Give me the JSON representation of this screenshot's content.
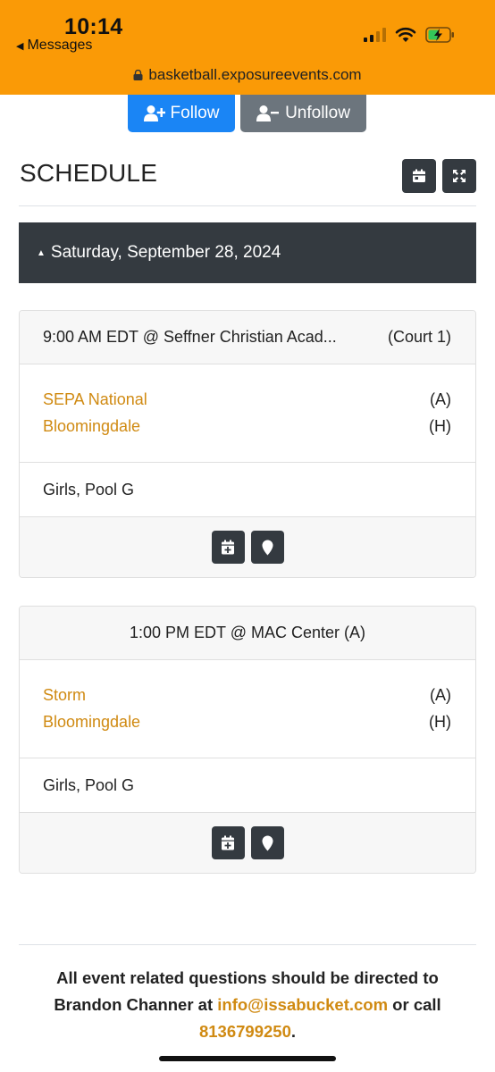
{
  "status_bar": {
    "time": "10:14",
    "back_label": "Messages",
    "url": "basketball.exposureevents.com",
    "chrome_color": "#fa9a06"
  },
  "actions": {
    "follow_label": "Follow",
    "unfollow_label": "Unfollow"
  },
  "schedule": {
    "title": "SCHEDULE",
    "date_header": "Saturday, September 28, 2024",
    "games": [
      {
        "time_location": "9:00 AM EDT @ Seffner Christian Acad...",
        "court": "(Court 1)",
        "teams": [
          {
            "name": "SEPA National",
            "side": "(A)"
          },
          {
            "name": "Bloomingdale",
            "side": "(H)"
          }
        ],
        "division": "Girls, Pool G"
      },
      {
        "time_location": "1:00 PM EDT @ MAC Center (A)",
        "court": "",
        "teams": [
          {
            "name": "Storm",
            "side": "(A)"
          },
          {
            "name": "Bloomingdale",
            "side": "(H)"
          }
        ],
        "division": "Girls, Pool G"
      }
    ]
  },
  "footer": {
    "text_1": "All event related questions should be directed to",
    "text_2": "Brandon Channer at ",
    "email": "info@issabucket.com",
    "text_3": " or call",
    "phone": "8136799250",
    "text_4": "."
  },
  "colors": {
    "primary": "#1a85f5",
    "secondary": "#6c757d",
    "dark": "#343a40",
    "team_link": "#d08a12"
  },
  "icons": [
    "back-triangle-icon",
    "signal-icon",
    "wifi-icon",
    "battery-charging-icon",
    "lock-icon",
    "user-plus-icon",
    "user-minus-icon",
    "calendar-icon",
    "expand-icon",
    "caret-up-icon",
    "calendar-plus-icon",
    "map-marker-icon"
  ]
}
